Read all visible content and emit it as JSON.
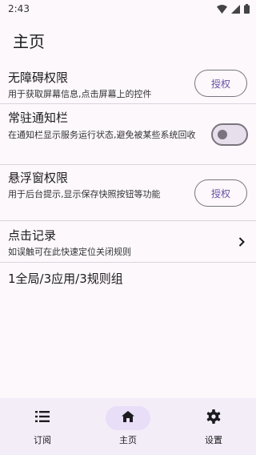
{
  "status_bar": {
    "time": "2:43"
  },
  "app_title": "主页",
  "rows": [
    {
      "title": "无障碍权限",
      "desc": "用于获取屏幕信息,点击屏幕上的控件",
      "button": "授权"
    },
    {
      "title": "常驻通知栏",
      "desc": "在通知栏显示服务运行状态,避免被某些系统回收",
      "switch_on": false
    },
    {
      "title": "悬浮窗权限",
      "desc": "用于后台提示,显示保存快照按钮等功能",
      "button": "授权"
    },
    {
      "title": "点击记录",
      "desc": "如误触可在此快速定位关闭规则"
    }
  ],
  "summary": "1全局/3应用/3规则组",
  "nav": [
    {
      "label": "订阅",
      "icon": "list-icon"
    },
    {
      "label": "主页",
      "icon": "home-icon",
      "selected": true
    },
    {
      "label": "设置",
      "icon": "gear-icon"
    }
  ],
  "colors": {
    "background": "#fdf8fc",
    "accent": "#6750a4",
    "nav_bg": "#f3edf7",
    "nav_pill": "#e8def8"
  }
}
